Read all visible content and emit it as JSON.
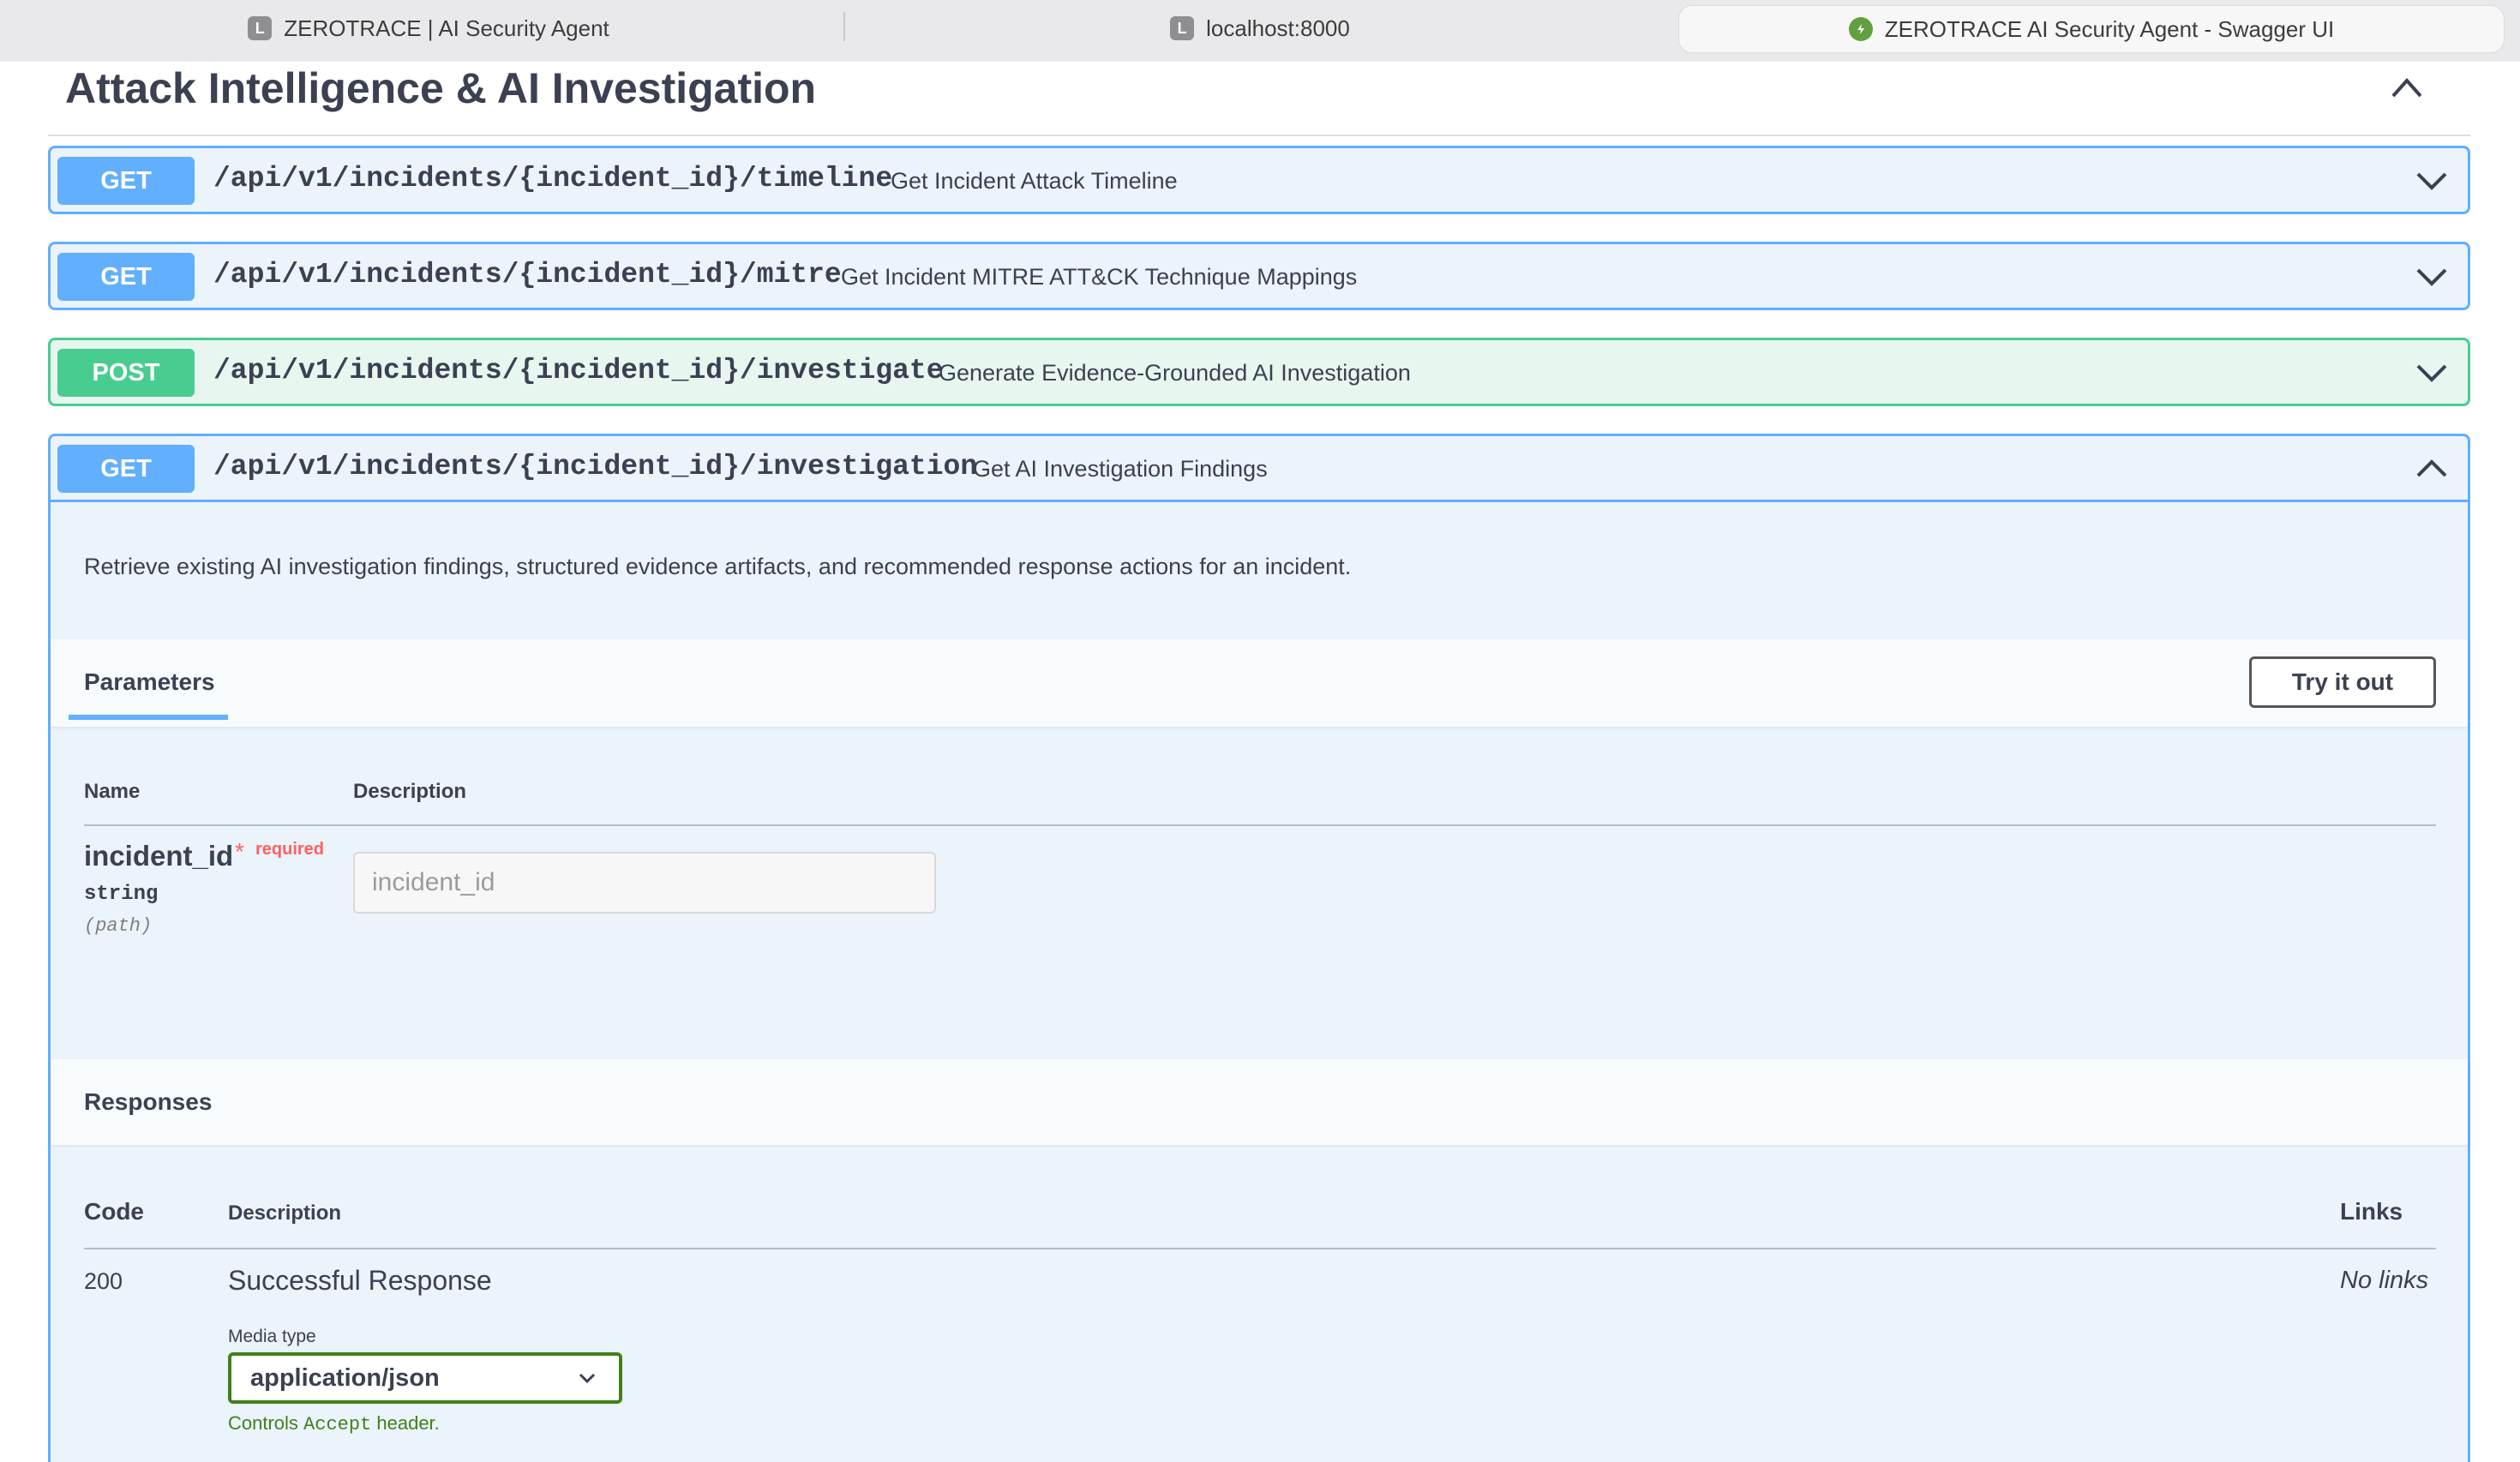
{
  "browser": {
    "tabs": [
      {
        "label": "ZEROTRACE | AI Security Agent",
        "favicon": "L"
      },
      {
        "label": "localhost:8000",
        "favicon": "L"
      },
      {
        "label": "ZEROTRACE AI Security Agent - Swagger UI",
        "favicon": "swagger-icon"
      }
    ]
  },
  "section": {
    "title": "Attack Intelligence & AI Investigation"
  },
  "operations": [
    {
      "method": "GET",
      "path": "/api/v1/incidents/{incident_id}/timeline",
      "summary": "Get Incident Attack Timeline"
    },
    {
      "method": "GET",
      "path": "/api/v1/incidents/{incident_id}/mitre",
      "summary": "Get Incident MITRE ATT&CK Technique Mappings"
    },
    {
      "method": "POST",
      "path": "/api/v1/incidents/{incident_id}/investigate",
      "summary": "Generate Evidence-Grounded AI Investigation"
    },
    {
      "method": "GET",
      "path": "/api/v1/incidents/{incident_id}/investigation",
      "summary": "Get AI Investigation Findings"
    }
  ],
  "expanded": {
    "description": "Retrieve existing AI investigation findings, structured evidence artifacts, and recommended response actions for an incident.",
    "parameters_label": "Parameters",
    "try_it_out": "Try it out",
    "columns": {
      "name": "Name",
      "description": "Description"
    },
    "param": {
      "name": "incident_id",
      "required_star": "*",
      "required": "required",
      "type": "string",
      "in": "(path)",
      "placeholder": "incident_id"
    },
    "responses": {
      "title": "Responses",
      "columns": {
        "code": "Code",
        "description": "Description",
        "links": "Links"
      },
      "row": {
        "code": "200",
        "description": "Successful Response",
        "links": "No links"
      },
      "media_type_label": "Media type",
      "media_type": "application/json",
      "controls_prefix": "Controls ",
      "controls_code": "Accept",
      "controls_suffix": " header."
    }
  },
  "colors": {
    "get": "#61affe",
    "post": "#49cc90",
    "get_bg": "#ebf3fb",
    "post_bg": "#e8f6f0",
    "required": "#ff6060",
    "media_border": "#41801a"
  }
}
